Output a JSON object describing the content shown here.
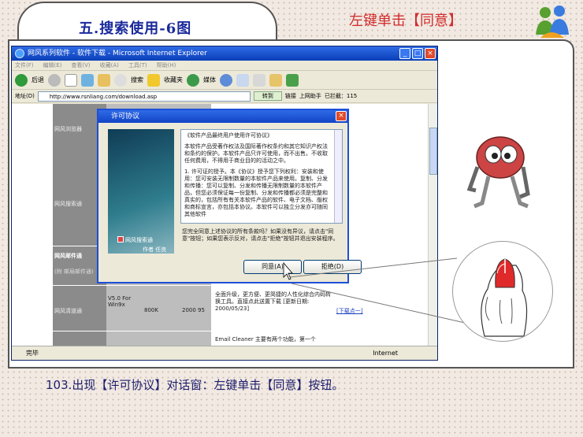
{
  "slide": {
    "title": "五.搜索使用-6图",
    "hint": "左键单击【同意】",
    "caption": "103.出现【许可协议】对话窗：左键单击【同意】按钮。"
  },
  "ie": {
    "window_title": "网风系列软件 - 软件下载 - Microsoft Internet Explorer",
    "menu": [
      "文件(F)",
      "编辑(E)",
      "查看(V)",
      "收藏(A)",
      "工具(T)",
      "帮助(H)"
    ],
    "toolbar": {
      "back": "后退",
      "search": "搜索",
      "favorites": "收藏夹",
      "media": "媒体"
    },
    "address_label": "地址(D)",
    "address": "http://www.rsnliang.com/download.asp",
    "go_label": "转到",
    "links_label": "链接",
    "online_label": "上网助手",
    "blocked_label": "已拦截：115",
    "status_left": "完毕",
    "status_zone": "Internet"
  },
  "page": {
    "categories": [
      "网风浏览器",
      "网风搜索通",
      "网风邮件通",
      "(附 邮局邮件通)",
      "网风清道通"
    ],
    "row_version": "V5.0 For Win9x",
    "row_size": "800K",
    "row_os": "2000 95",
    "row_desc": "全面升级，更方便、更简捷的人性化综合内码转换工具。直接点此送置下载 [更新日期: 2000/05/23]",
    "row_link": "[下载点一]",
    "row_next": "Email Cleaner 主要有两个功能，第一个"
  },
  "dialog": {
    "title": "许可协议",
    "license_title": "《软件产品最终用户使用许可协议》",
    "license_p1": "本软件产品受著作权法及国际著作权条约和其它知识产权法和条约的保护。本软件产品只许可使用，而不出售。不收取任何费用，不得用于商业目的的活动之中。",
    "license_p2": "1. 许可证的授予。本《协议》授予您下列权利：安装和使用：您可安装无限制数量的本软件产品来使用。复制、分发和传播：您可以复制、分发和传播无限制数量的本软件产品，但您必须保证每一份复制、分发和传播都必须是完整和真实的，包括所有有关本软件产品的软件、电子文档、版权和商标宣言，亦包括本协议。本软件可以独立分发亦可随同其他软件",
    "question": "您完全同意上述协议的所有条款吗？如果没有异议，请点击\"同意\"按钮；如果您表示反对，请点击\"拒绝\"按钮并退出安装程序。",
    "banner_product": "网风搜索通",
    "banner_author": "作者 任良",
    "agree_label": "同意(A)",
    "decline_label": "拒绝(D)"
  },
  "colors": {
    "hint": "#d32d2d",
    "title": "#1a2a9c",
    "caption": "#1e1e6e",
    "xp_blue": "#1d4fd8"
  }
}
